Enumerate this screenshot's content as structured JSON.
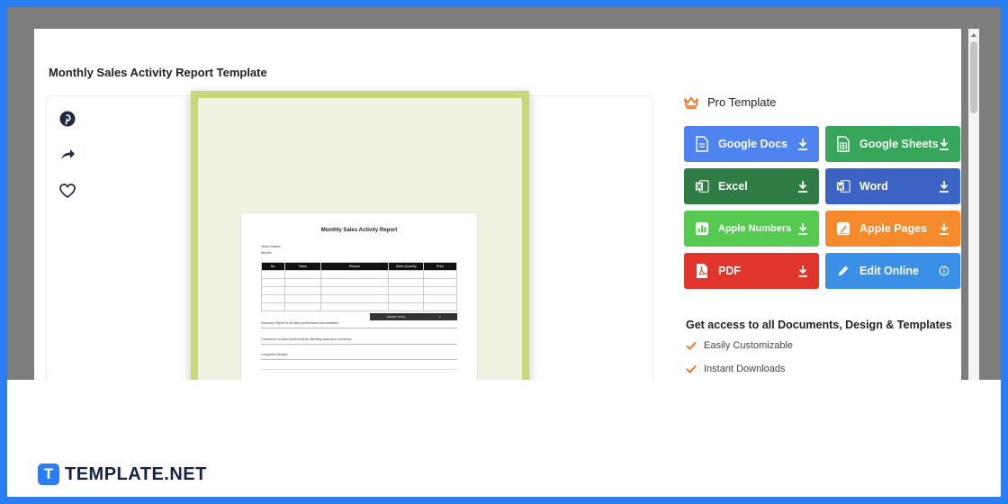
{
  "page": {
    "title": "Monthly Sales Activity Report Template"
  },
  "share_icons": [
    "pinterest-icon",
    "share-icon",
    "heart-icon"
  ],
  "preview": {
    "doc_title": "Monthly Sales Activity Report",
    "meta_lines": [
      "Team Name:",
      "Month:"
    ],
    "table_headers": [
      "No.",
      "Tasks",
      "Reason",
      "Sales Quantity",
      "Price"
    ],
    "total_label": "GRAND TOTAL",
    "total_value": "0",
    "lines": [
      "Summary Report of all sales performance and activities:",
      "Comments on team achievements affecting sales and customers:",
      "Competitor Activity:"
    ]
  },
  "sidebar": {
    "pro_label": "Pro Template",
    "buttons": [
      {
        "label": "Google Docs",
        "icon": "google-docs-icon",
        "color": "#4f84f0"
      },
      {
        "label": "Google Sheets",
        "icon": "google-sheets-icon",
        "color": "#36a65a"
      },
      {
        "label": "Excel",
        "icon": "excel-icon",
        "color": "#2f7d45"
      },
      {
        "label": "Word",
        "icon": "word-icon",
        "color": "#3a63c4"
      },
      {
        "label": "Apple Numbers",
        "icon": "apple-numbers-icon",
        "color": "#55c950"
      },
      {
        "label": "Apple Pages",
        "icon": "apple-pages-icon",
        "color": "#f58a2d"
      },
      {
        "label": "PDF",
        "icon": "pdf-icon",
        "color": "#e0352a"
      },
      {
        "label": "Edit Online",
        "icon": "edit-online-icon",
        "color": "#3a8fe6"
      }
    ],
    "access_title": "Get access to all Documents, Design & Templates",
    "features": [
      "Easily Customizable",
      "Instant Downloads"
    ]
  },
  "brand": {
    "logo_letter": "T",
    "name": "TEMPLATE.NET"
  },
  "colors": {
    "brand_blue": "#2b7ef2",
    "frame_green": "#c8d77a",
    "accent_orange": "#f26b1d"
  }
}
